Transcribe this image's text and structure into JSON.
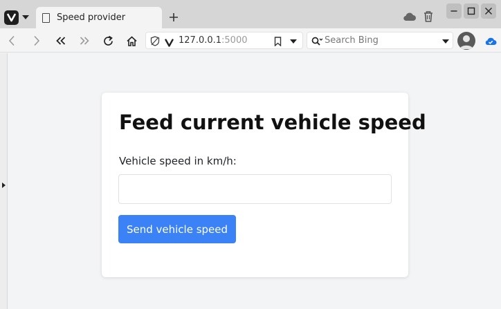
{
  "browser": {
    "tab": {
      "title": "Speed provider"
    },
    "address": {
      "host": "127.0.0.1",
      "port": ":5000"
    },
    "search": {
      "placeholder": "Search Bing"
    }
  },
  "page": {
    "title": "Feed current vehicle speed",
    "speed_label": "Vehicle speed in km/h:",
    "speed_value": "",
    "send_label": "Send vehicle speed"
  },
  "colors": {
    "primary_button": "#3b82f6",
    "page_background": "#f3f4f6",
    "card_background": "#ffffff"
  }
}
